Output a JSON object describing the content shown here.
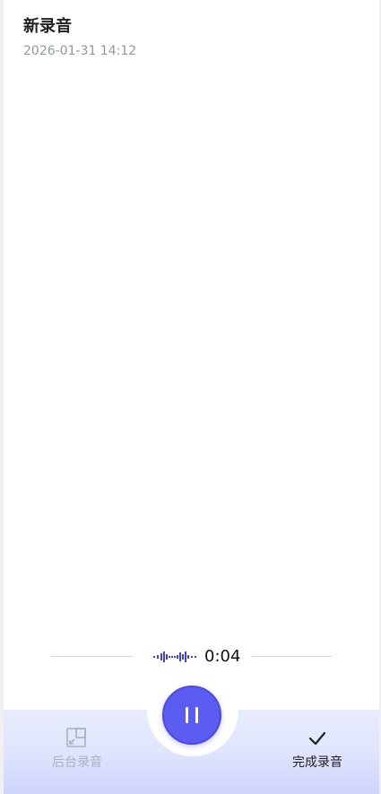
{
  "recording": {
    "title": "新录音",
    "date": "2026-01-31 14:12",
    "elapsed": "0:04"
  },
  "controls": {
    "background_label": "后台录音",
    "finish_label": "完成录音",
    "accent_color": "#5a5cf2"
  },
  "icons": {
    "background": "minimize-to-corner-icon",
    "pause": "pause-icon",
    "finish": "checkmark-icon",
    "waveform": "audio-waveform-icon"
  }
}
